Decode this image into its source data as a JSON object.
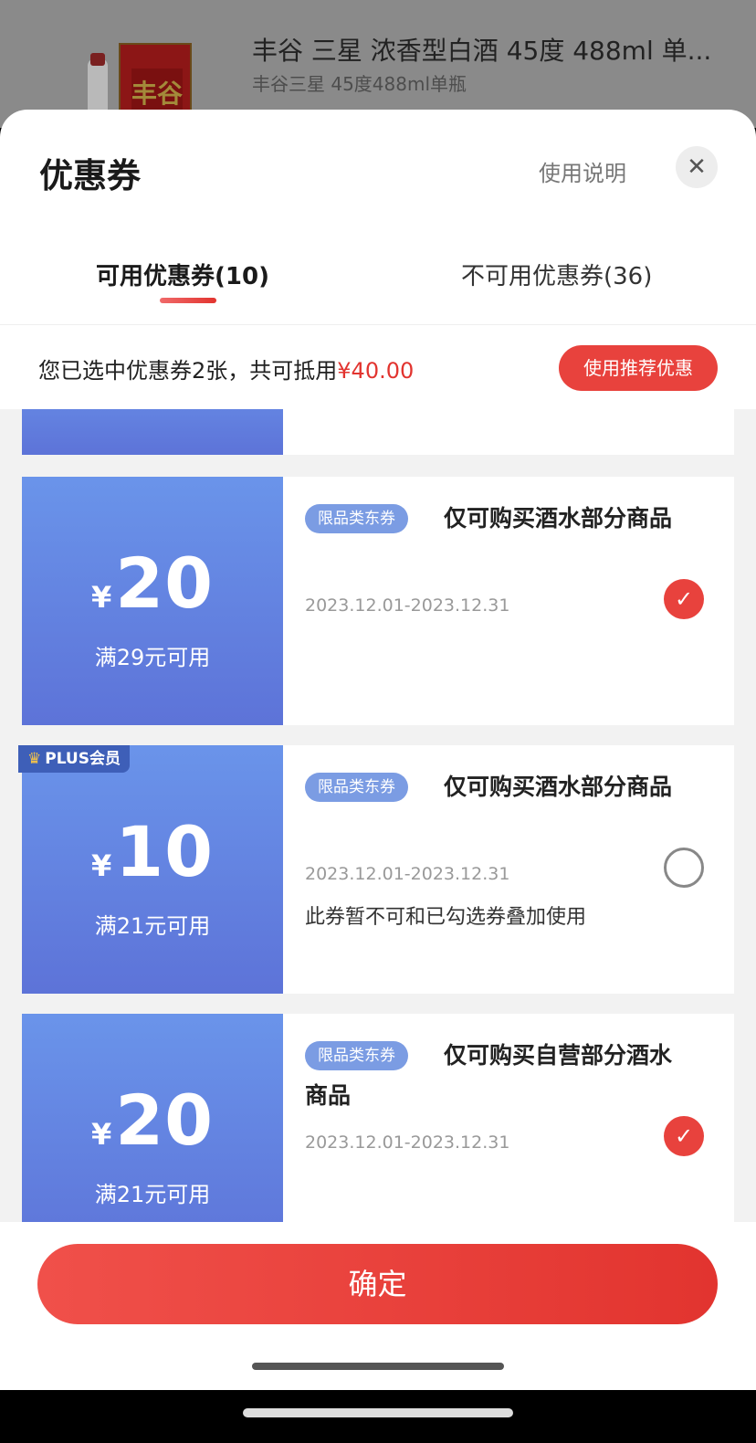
{
  "product": {
    "title": "丰谷 三星 浓香型白酒 45度 488ml 单...",
    "subtitle": "丰谷三星 45度488ml单瓶",
    "box_label": "丰谷"
  },
  "sheet": {
    "title": "优惠券",
    "help_label": "使用说明",
    "close_icon": "✕"
  },
  "tabs": [
    {
      "label": "可用优惠券(10)"
    },
    {
      "label": "不可用优惠券(36)"
    }
  ],
  "summary": {
    "text": "您已选中优惠券2张，共可抵用",
    "amount": "¥40.00",
    "recommend_label": "使用推荐优惠"
  },
  "coupons": [
    {
      "currency": "¥",
      "amount": "20",
      "condition": "满29元可用",
      "tag": "限品类东券",
      "description": "仅可购买酒水部分商品",
      "date_range": "2023.12.01-2023.12.31",
      "note": "",
      "selected": true,
      "badge": ""
    },
    {
      "currency": "¥",
      "amount": "10",
      "condition": "满21元可用",
      "tag": "限品类东券",
      "description": "仅可购买酒水部分商品",
      "date_range": "2023.12.01-2023.12.31",
      "note": "此券暂不可和已勾选券叠加使用",
      "selected": false,
      "badge": "PLUS会员"
    },
    {
      "currency": "¥",
      "amount": "20",
      "condition": "满21元可用",
      "tag": "限品类东券",
      "description": "仅可购买自营部分酒水商品",
      "date_range": "2023.12.01-2023.12.31",
      "note": "",
      "selected": true,
      "badge": ""
    }
  ],
  "confirm_label": "确定",
  "colors": {
    "accent": "#e8423d",
    "coupon_blue_top": "#6a94ea",
    "coupon_blue_bottom": "#5d73d8",
    "tag_blue": "#7b9ce3"
  },
  "icons": {
    "check": "checkmark-icon",
    "crown": "crown-icon",
    "close": "close-icon"
  }
}
